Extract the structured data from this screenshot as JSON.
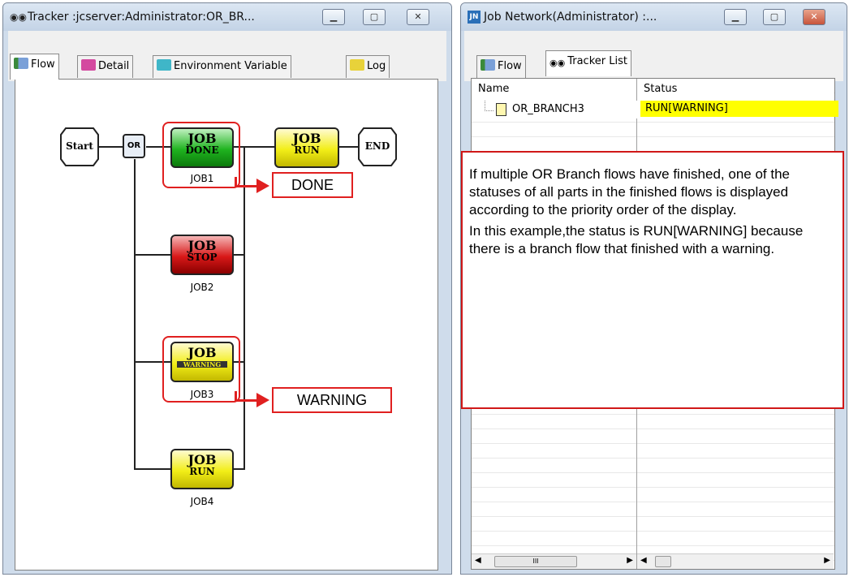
{
  "left_window": {
    "title": "Tracker :jcserver:Administrator:OR_BR...",
    "title_icon": "tracker-glasses-icon",
    "tabs": [
      {
        "label": "Flow",
        "icon": "flow-icon"
      },
      {
        "label": "Detail",
        "icon": "detail-book-icon"
      },
      {
        "label": "Environment Variable",
        "icon": "env-book-icon"
      },
      {
        "label": "Log",
        "icon": "log-book-icon"
      }
    ],
    "flow": {
      "start_label": "Start",
      "end_label": "END",
      "jobs": [
        {
          "name": "JOB1",
          "top": "JOB",
          "bottom": "DONE"
        },
        {
          "name": "JOB2",
          "top": "JOB",
          "bottom": "STOP"
        },
        {
          "name": "JOB3",
          "top": "JOB",
          "bottom": "WARNING"
        },
        {
          "name": "JOB4",
          "top": "JOB",
          "bottom": "RUN"
        }
      ],
      "end_job": {
        "top": "JOB",
        "bottom": "RUN"
      },
      "annotations": {
        "done": "DONE",
        "warning": "WARNING"
      }
    },
    "scrollbar_glyph": "III"
  },
  "right_window": {
    "title": "Job Network(Administrator) :...",
    "tabs": [
      {
        "label": "Flow",
        "icon": "flow-icon"
      },
      {
        "label": "Tracker List",
        "icon": "tracker-glasses-icon"
      }
    ],
    "columns": [
      "Name",
      "Status"
    ],
    "rows": [
      {
        "name": "OR_BRANCH3",
        "status": "RUN[WARNING]",
        "status_color": "#ffff00"
      }
    ],
    "scrollbar_glyph": "III"
  },
  "callout": {
    "paragraph1": "If multiple OR Branch flows have finished, one of the statuses of all parts in the finished flows is displayed according to the priority order of the display.",
    "paragraph2": "In this example,the status is RUN[WARNING] because there is a branch flow that finished with a warning."
  },
  "colors": {
    "done_green": "#1fb31f",
    "stop_red": "#d81818",
    "warning_yellow": "#f2ee18",
    "run_yellow": "#f2ee18",
    "annotation_red": "#e02020"
  }
}
